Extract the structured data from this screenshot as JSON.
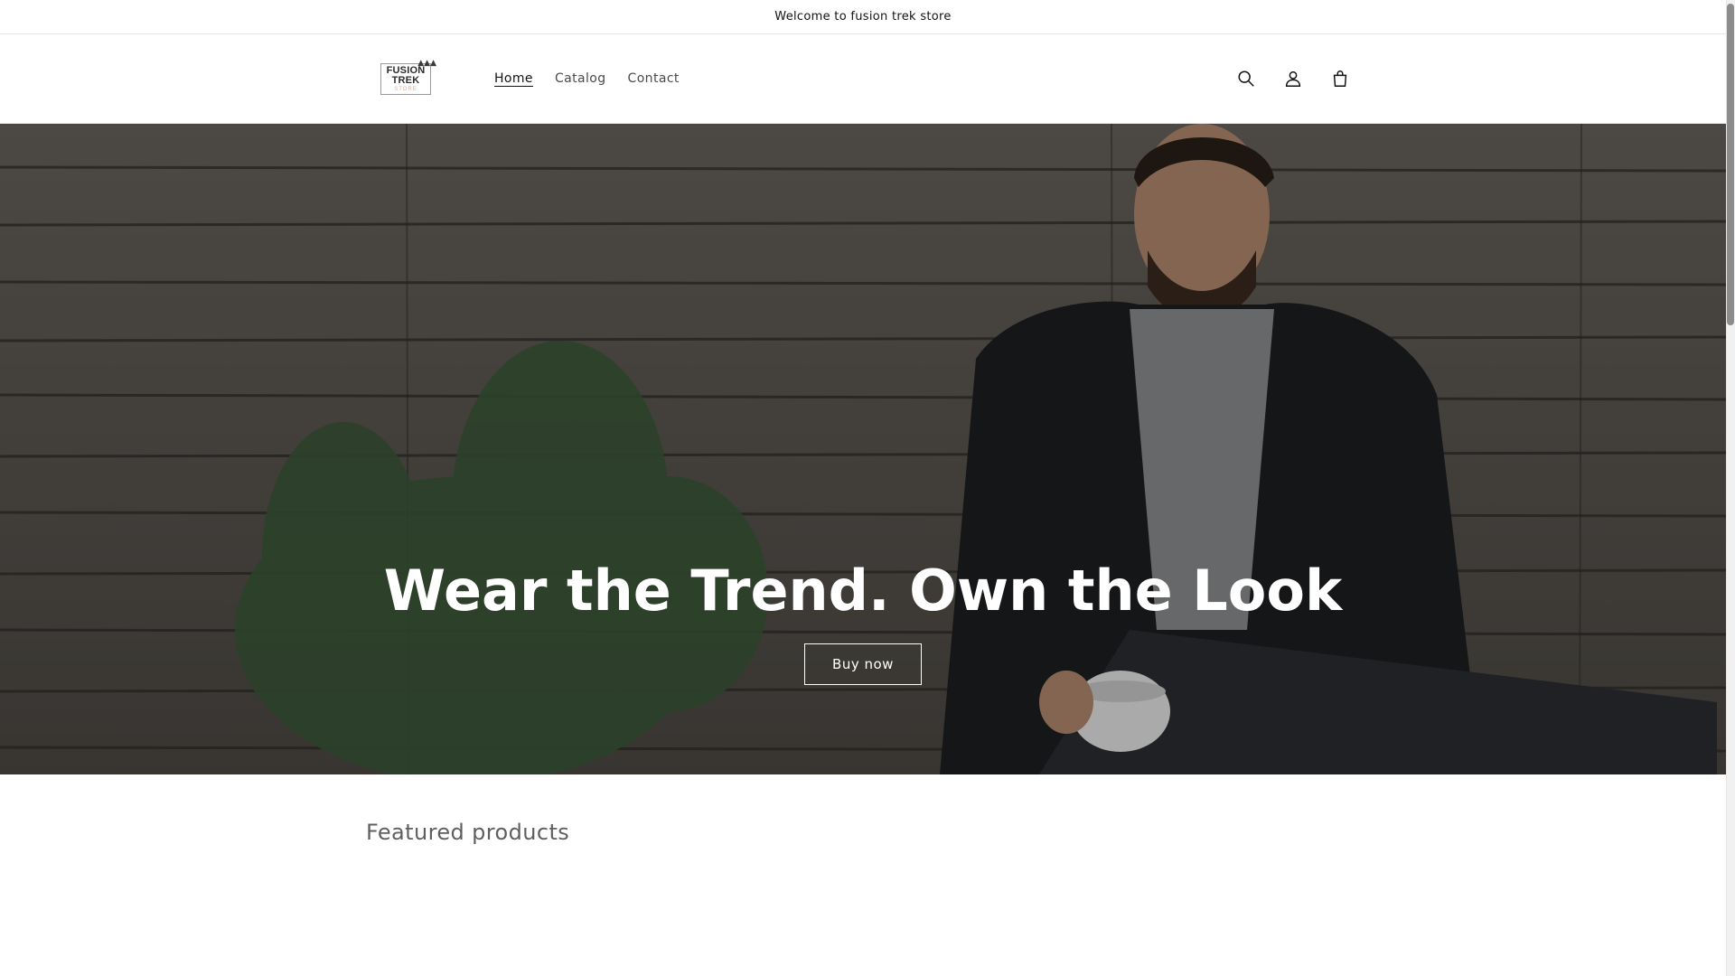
{
  "announcement": {
    "text": "Welcome to fusion trek store"
  },
  "logo": {
    "line1": "FUSION",
    "line2": "TREK",
    "line3": "STORE"
  },
  "nav": {
    "items": [
      {
        "label": "Home",
        "active": true
      },
      {
        "label": "Catalog",
        "active": false
      },
      {
        "label": "Contact",
        "active": false
      }
    ]
  },
  "header_icons": [
    "search-icon",
    "account-icon",
    "cart-icon"
  ],
  "hero": {
    "title": "Wear the Trend. Own the Look",
    "button_label": "Buy now"
  },
  "featured": {
    "title": "Featured products"
  },
  "colors": {
    "text": "#121212",
    "hero_overlay": "#000000",
    "hero_text": "#ffffff",
    "muted_heading": "#5f5f5f"
  }
}
